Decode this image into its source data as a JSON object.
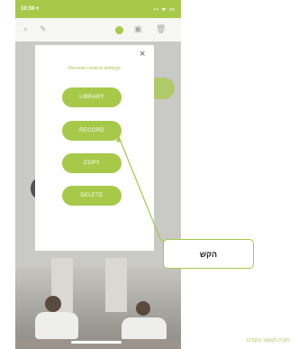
{
  "status_bar": {
    "time": "10:59 ▾",
    "icons": "▪▪ ᯤ ▭"
  },
  "toolbar": {
    "search_icon": "⌕",
    "edit_icon": "✎",
    "camera_icon": "▣",
    "trash_icon": "🗑"
  },
  "modal": {
    "title": "Remote control settings",
    "close": "×",
    "buttons": [
      "LIBRARY",
      "RECORD",
      "COPY",
      "DELETE"
    ]
  },
  "callout": {
    "text": "הקש"
  },
  "footer": {
    "link": "חזרה לעמוד הקודם"
  },
  "colors": {
    "accent": "#a6c94a"
  }
}
